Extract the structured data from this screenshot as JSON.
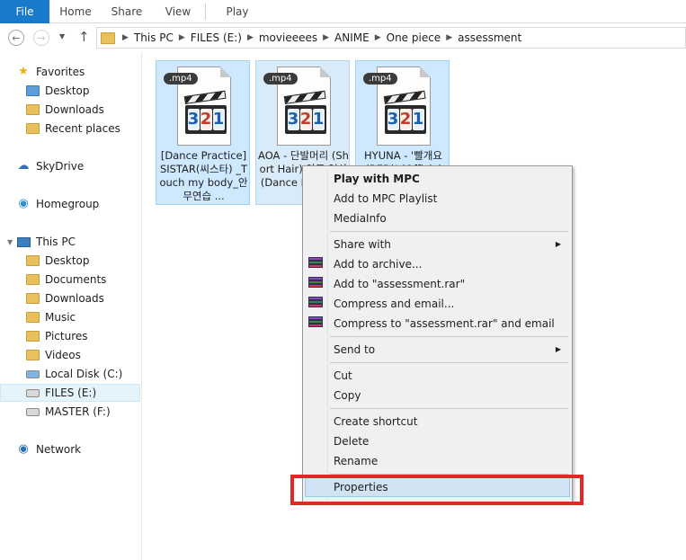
{
  "ribbon": {
    "tabs": [
      "File",
      "Home",
      "Share",
      "View",
      "Play"
    ]
  },
  "address": {
    "crumbs": [
      "This PC",
      "FILES (E:)",
      "movieeees",
      "ANIME",
      "One piece",
      "assessment"
    ]
  },
  "nav": {
    "favorites": "Favorites",
    "fav_items": [
      "Desktop",
      "Downloads",
      "Recent places"
    ],
    "skydrive": "SkyDrive",
    "homegroup": "Homegroup",
    "thispc": "This PC",
    "pc_items": [
      "Desktop",
      "Documents",
      "Downloads",
      "Music",
      "Pictures",
      "Videos",
      "Local Disk (C:)",
      "FILES (E:)",
      "MASTER (F:)"
    ],
    "network": "Network"
  },
  "files": [
    {
      "ext": ".mp4",
      "name": "[Dance Practice] SISTAR(씨스타) _Touch my body_안무연습 ..."
    },
    {
      "ext": ".mp4",
      "name": "AOA - 단발머리 (Short Hair) 안무 영상(Dance Practice)"
    },
    {
      "ext": ".mp4",
      "name": "HYUNA - '빨개요 (RED)' (Official"
    }
  ],
  "context_menu": {
    "play": "Play with MPC",
    "add_playlist": "Add to MPC Playlist",
    "mediainfo": "MediaInfo",
    "share_with": "Share with",
    "add_archive": "Add to archive...",
    "add_rar": "Add to \"assessment.rar\"",
    "compress_email": "Compress and email...",
    "compress_rar_email": "Compress to \"assessment.rar\" and email",
    "send_to": "Send to",
    "cut": "Cut",
    "copy": "Copy",
    "create_shortcut": "Create shortcut",
    "delete": "Delete",
    "rename": "Rename",
    "properties": "Properties"
  },
  "icons": {
    "player_digits": [
      "3",
      "2",
      "1"
    ],
    "highlight_color": "#e32626",
    "selection_color": "#cde8ff"
  }
}
